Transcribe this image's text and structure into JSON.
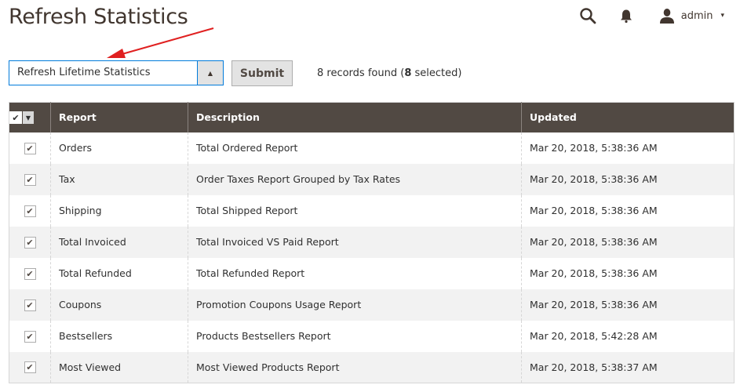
{
  "page": {
    "title": "Refresh Statistics"
  },
  "header": {
    "search_icon": "search-icon",
    "notifications_icon": "bell-icon",
    "user_icon": "user-icon",
    "user_name": "admin",
    "user_caret": "▾"
  },
  "actions": {
    "selected_action": "Refresh Lifetime Statistics",
    "toggle_glyph": "▲",
    "submit_label": "Submit",
    "records_prefix": "8 records found (",
    "selected_count": "8",
    "records_suffix": " selected)"
  },
  "annotation": {
    "arrow_color": "#e02020"
  },
  "grid": {
    "mass_check_glyph": "✔",
    "mass_drop_glyph": "▼",
    "columns": [
      "Report",
      "Description",
      "Updated"
    ],
    "check_glyph": "✔",
    "rows": [
      {
        "report": "Orders",
        "description": "Total Ordered Report",
        "updated": "Mar 20, 2018, 5:38:36 AM",
        "checked": true
      },
      {
        "report": "Tax",
        "description": "Order Taxes Report Grouped by Tax Rates",
        "updated": "Mar 20, 2018, 5:38:36 AM",
        "checked": true
      },
      {
        "report": "Shipping",
        "description": "Total Shipped Report",
        "updated": "Mar 20, 2018, 5:38:36 AM",
        "checked": true
      },
      {
        "report": "Total Invoiced",
        "description": "Total Invoiced VS Paid Report",
        "updated": "Mar 20, 2018, 5:38:36 AM",
        "checked": true
      },
      {
        "report": "Total Refunded",
        "description": "Total Refunded Report",
        "updated": "Mar 20, 2018, 5:38:36 AM",
        "checked": true
      },
      {
        "report": "Coupons",
        "description": "Promotion Coupons Usage Report",
        "updated": "Mar 20, 2018, 5:38:36 AM",
        "checked": true
      },
      {
        "report": "Bestsellers",
        "description": "Products Bestsellers Report",
        "updated": "Mar 20, 2018, 5:42:28 AM",
        "checked": true
      },
      {
        "report": "Most Viewed",
        "description": "Most Viewed Products Report",
        "updated": "Mar 20, 2018, 5:38:37 AM",
        "checked": true
      }
    ]
  }
}
